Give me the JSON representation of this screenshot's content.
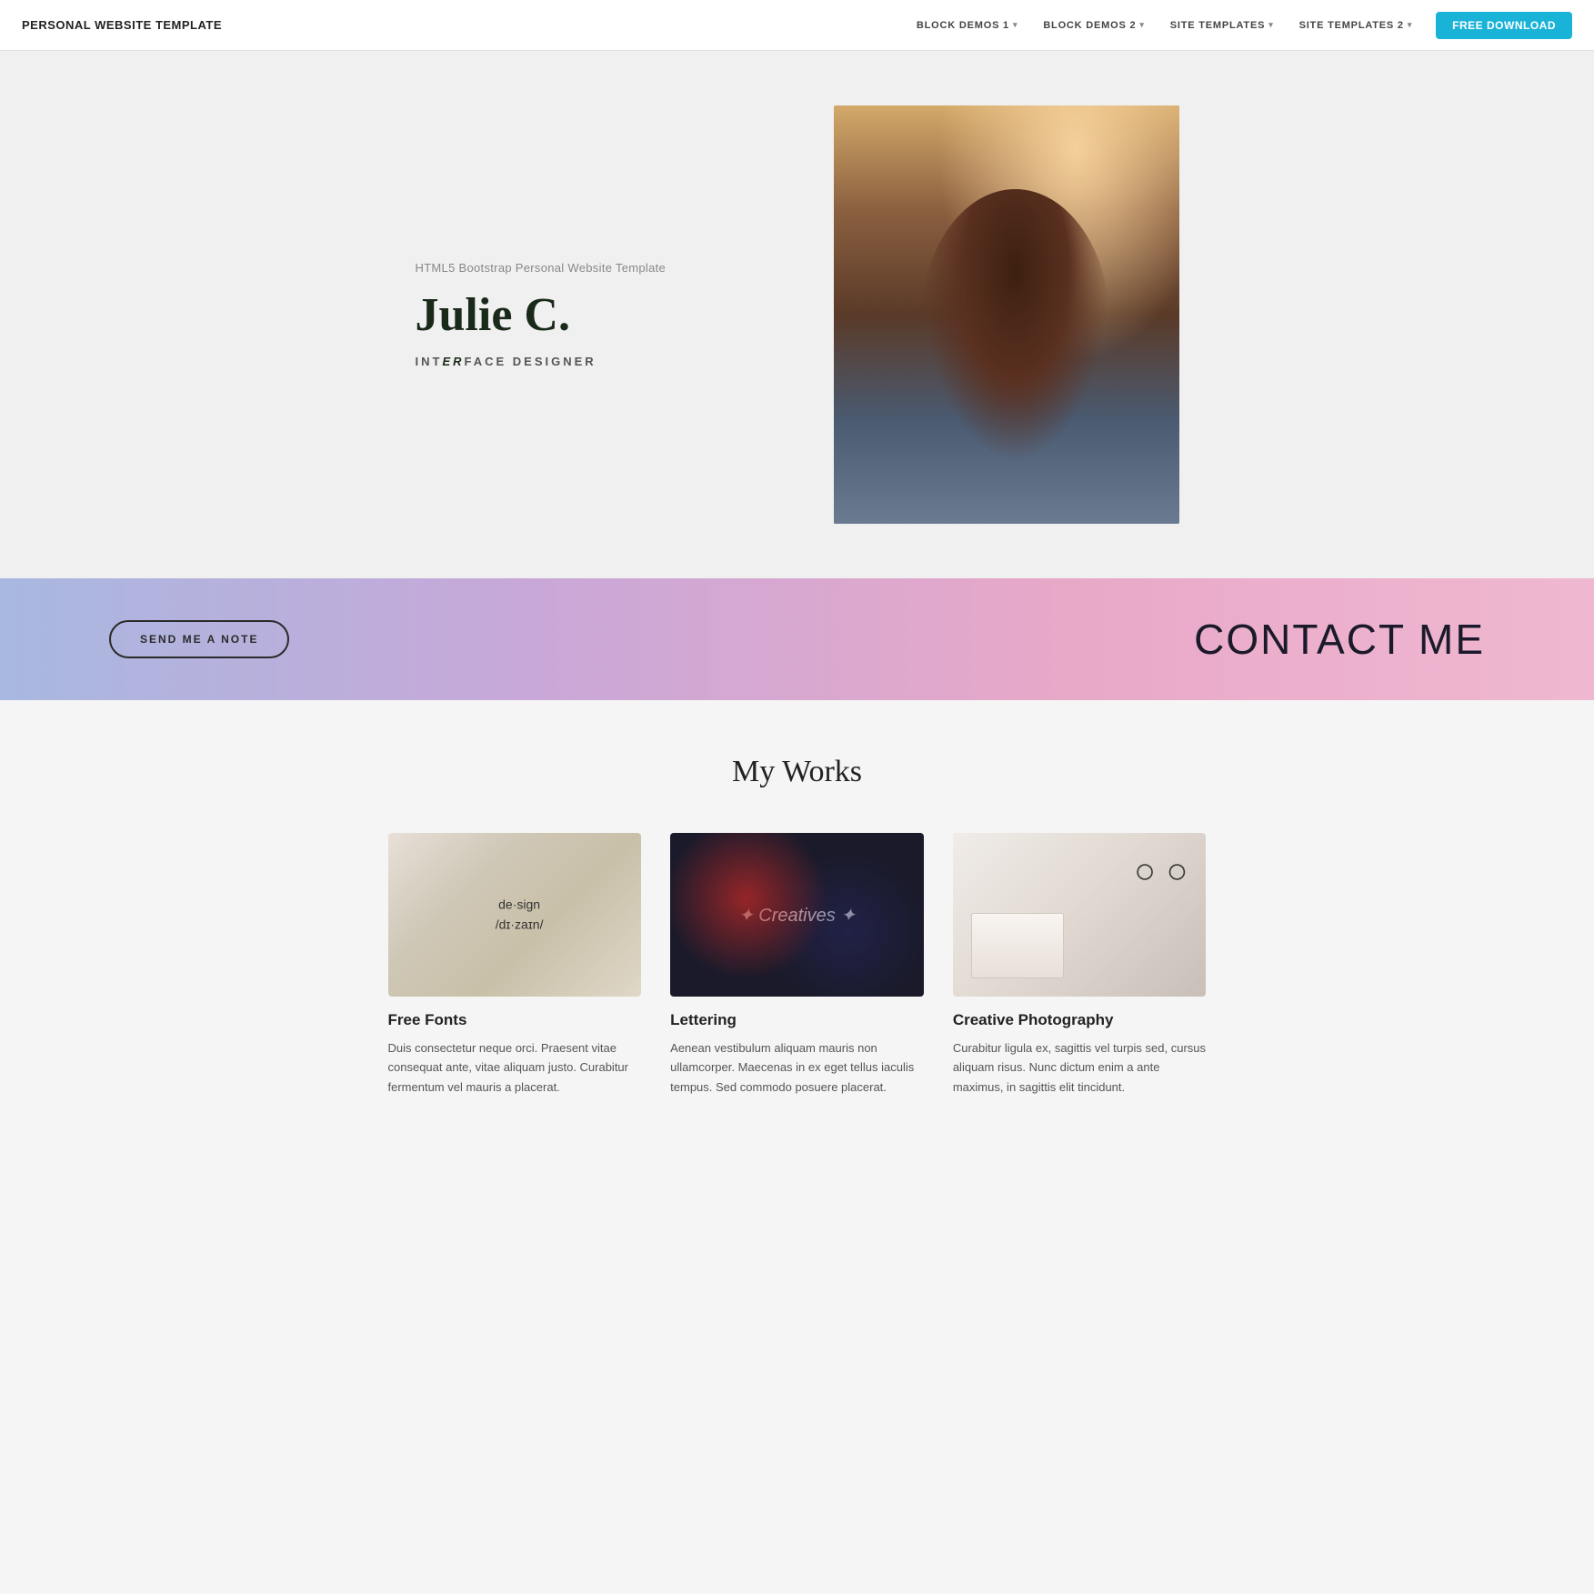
{
  "nav": {
    "brand": "PERSONAL WEBSITE TEMPLATE",
    "links": [
      {
        "label": "BLOCK DEMOS 1",
        "has_caret": true
      },
      {
        "label": "BLOCK DEMOS 2",
        "has_caret": true
      },
      {
        "label": "SITE TEMPLATES",
        "has_caret": true
      },
      {
        "label": "SITE TEMPLATES 2",
        "has_caret": true
      }
    ],
    "download_label": "FREE DOWNLOAD"
  },
  "hero": {
    "subtitle": "HTML5 Bootstrap Personal Website Template",
    "name": "Julie C.",
    "title_prefix": "INT",
    "title_italic": "ER",
    "title_suffix": "FACE DESIGNER"
  },
  "contact": {
    "button_label": "SEND ME A NOTE",
    "heading": "CONTACT ME"
  },
  "works": {
    "heading": "My Works",
    "items": [
      {
        "title": "Free Fonts",
        "description": "Duis consectetur neque orci. Praesent vitae consequat ante, vitae aliquam justo. Curabitur fermentum vel mauris a placerat."
      },
      {
        "title": "Lettering",
        "description": "Aenean vestibulum aliquam mauris non ullamcorper. Maecenas in ex eget tellus iaculis tempus. Sed commodo posuere placerat."
      },
      {
        "title": "Creative Photography",
        "description": "Curabitur ligula ex, sagittis vel turpis sed, cursus aliquam risus. Nunc dictum enim a ante maximus, in sagittis elit tincidunt."
      }
    ]
  }
}
